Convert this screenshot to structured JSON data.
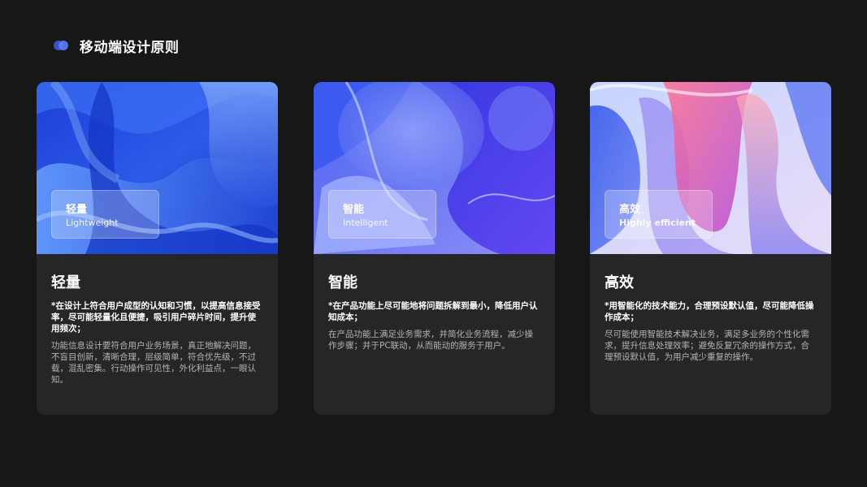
{
  "header": {
    "title": "移动端设计原则"
  },
  "cards": [
    {
      "overlay_title": "轻量",
      "overlay_subtitle": "Lightweight",
      "title": "轻量",
      "lead": "*在设计上符合用户成型的认知和习惯，以提高信息接受率，尽可能轻量化且便捷，吸引用户碎片时间，提升使用频次；",
      "body": "功能信息设计要符合用户业务场景，真正地解决问题，不盲目创新，清晰合理，层级简单，符合优先级，不过载，混乱密集。行动操作可见性，外化利益点，一眼认知。"
    },
    {
      "overlay_title": "智能",
      "overlay_subtitle": "Intelligent",
      "title": "智能",
      "lead": "*在产品功能上尽可能地将问题拆解到最小，降低用户认知成本；",
      "body": "在产品功能上满足业务需求，并简化业务流程，减少操作步骤；并于PC联动，从而能动的服务于用户。"
    },
    {
      "overlay_title": "高效",
      "overlay_subtitle": "Highly efficient",
      "title": "高效",
      "lead": "*用智能化的技术能力，合理预设默认值，尽可能降低操作成本；",
      "body": "尽可能使用智能技术解决业务，满足多业务的个性化需求，提升信息处理效率；避免反复冗余的操作方式，合理预设默认值，为用户减少重复的操作。"
    }
  ]
}
